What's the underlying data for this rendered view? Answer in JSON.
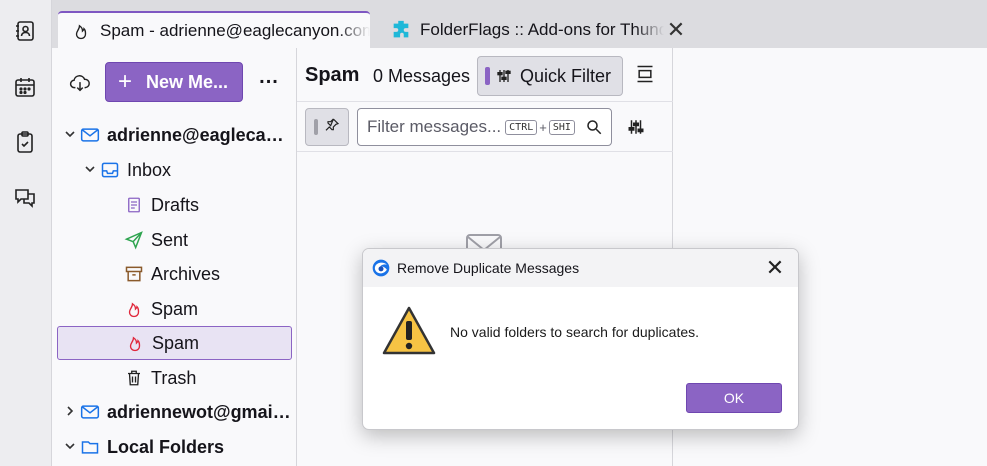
{
  "tabs": [
    {
      "title": "Spam - adrienne@eaglecanyon.com",
      "icon": "spam-flame-icon",
      "active": true
    },
    {
      "title": "FolderFlags :: Add-ons for Thunderbird",
      "icon": "puzzle-icon",
      "active": false
    }
  ],
  "spaces": [
    "address-book-icon",
    "calendar-icon",
    "tasks-icon",
    "chat-icon"
  ],
  "folder_pane": {
    "new_message_label": "New Me...",
    "more_label": "...",
    "tree": [
      {
        "label": "adrienne@eaglecanyon.com",
        "level": 0,
        "twisty": "open",
        "icon": "account-icon",
        "bold": true
      },
      {
        "label": "Inbox",
        "level": 1,
        "twisty": "open",
        "icon": "inbox-icon",
        "bold": false
      },
      {
        "label": "Drafts",
        "level": 2,
        "twisty": "",
        "icon": "drafts-icon",
        "bold": false
      },
      {
        "label": "Sent",
        "level": 2,
        "twisty": "",
        "icon": "sent-icon",
        "bold": false
      },
      {
        "label": "Archives",
        "level": 2,
        "twisty": "",
        "icon": "archive-icon",
        "bold": false
      },
      {
        "label": "Spam",
        "level": 2,
        "twisty": "",
        "icon": "spam-flame-icon",
        "bold": false
      },
      {
        "label": "Spam",
        "level": 2,
        "twisty": "",
        "icon": "spam-flame-icon",
        "bold": false,
        "selected": true
      },
      {
        "label": "Trash",
        "level": 2,
        "twisty": "",
        "icon": "trash-icon",
        "bold": false
      },
      {
        "label": "adriennewot@gmail.com",
        "level": 0,
        "twisty": "closed",
        "icon": "account-icon",
        "bold": true
      },
      {
        "label": "Local Folders",
        "level": 0,
        "twisty": "open",
        "icon": "folder-icon",
        "bold": true
      }
    ]
  },
  "thread_pane": {
    "folder_name": "Spam",
    "message_count": "0 Messages",
    "quick_filter_label": "Quick Filter",
    "filter_placeholder": "Filter messages...",
    "shortcut_key1": "CTRL",
    "shortcut_plus": "+",
    "shortcut_key2": "SHI"
  },
  "dialog": {
    "title": "Remove Duplicate Messages",
    "message": "No valid folders to search for duplicates.",
    "ok_label": "OK",
    "close_label": "✕"
  },
  "colors": {
    "accent": "#8b64c4",
    "warning": "#f6c344",
    "spam": "#e0283c"
  }
}
